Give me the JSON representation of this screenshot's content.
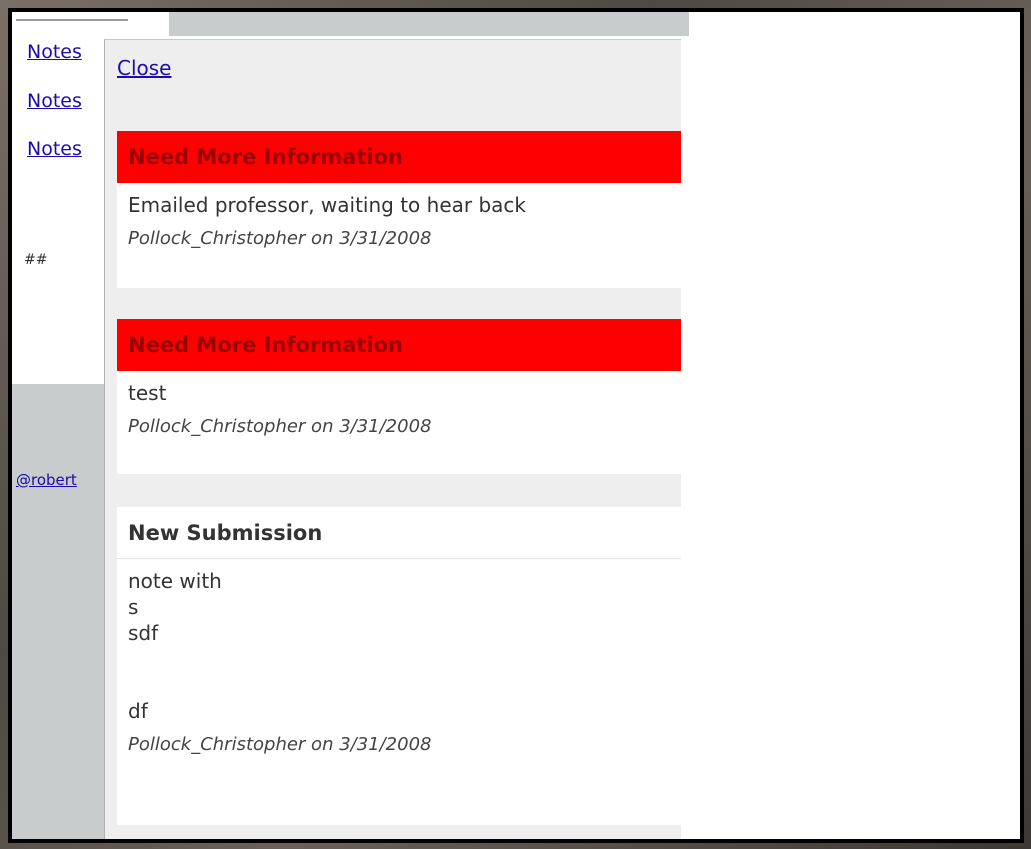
{
  "background_page": {
    "links": [
      "Notes",
      "Notes",
      "Notes"
    ],
    "hash_text": "##",
    "footer_link": "@robert"
  },
  "popup": {
    "close_label": "Close",
    "notes": [
      {
        "status": "Need More Information",
        "status_color": "#ff0000",
        "body": "Emailed professor, waiting to hear back",
        "meta": "Pollock_Christopher on 3/31/2008"
      },
      {
        "status": "Need More Information",
        "status_color": "#ff0000",
        "body": "test",
        "meta": "Pollock_Christopher on 3/31/2008"
      },
      {
        "status": "New Submission",
        "status_color": "#ffffff",
        "body": "note with\ns\nsdf\n\n\ndf",
        "meta": "Pollock_Christopher on 3/31/2008"
      }
    ]
  }
}
